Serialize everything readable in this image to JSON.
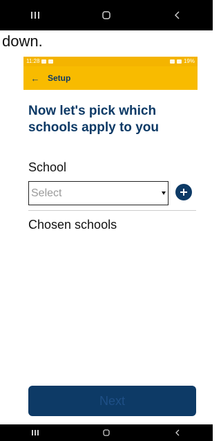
{
  "partial_text": "down.",
  "status_bar": {
    "time": "11:28",
    "battery": "19%"
  },
  "app_bar": {
    "back_glyph": "←",
    "title": "Setup"
  },
  "heading": "Now let's pick which schools apply to you",
  "school": {
    "label": "School",
    "placeholder": "Select"
  },
  "chosen_label": "Chosen schools",
  "next_label": "Next",
  "colors": {
    "accent": "#f8bb00",
    "primary": "#0d3a66",
    "nav": "#000000"
  }
}
